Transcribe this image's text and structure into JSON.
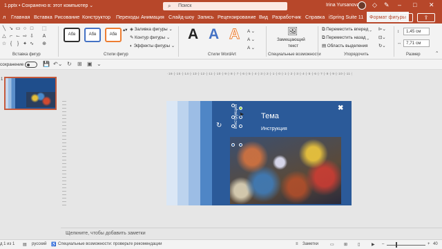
{
  "titlebar": {
    "filename": "1.pptx  •  Сохранено в: этот компьютер  ⌄",
    "search_placeholder": "Поиск",
    "user": "Irina Yursanova"
  },
  "tabs": [
    "Главная",
    "Вставка",
    "Рисование",
    "Конструктор",
    "Переходы",
    "Анимация",
    "Слайд-шоу",
    "Запись",
    "Рецензирование",
    "Вид",
    "Разработчик",
    "Справка",
    "iSpring Suite 11",
    "Формат фигуры"
  ],
  "ribbon": {
    "groups": {
      "insert_shapes": "Вставка фигур",
      "shape_styles": "Стили фигур",
      "wordart": "Стили WordArt",
      "accessibility": "Специальные возможности",
      "arrange": "Упорядочить",
      "size": "Размер"
    },
    "style_samples": [
      "Абв",
      "Абв",
      "Абв"
    ],
    "shape_fill": "Заливка фигуры ⌄",
    "shape_outline": "Контур фигуры ⌄",
    "shape_effects": "Эффекты фигуры ⌄",
    "wordart_letter": "A",
    "alt_text_line1": "Замещающий",
    "alt_text_line2": "текст",
    "bring_forward": "Переместить вперед",
    "send_backward": "Переместить назад",
    "selection_pane": "Область выделения",
    "height": "1,45 см",
    "width": "7,71 см"
  },
  "qat": {
    "autosave_label": "сохранение"
  },
  "ruler_text": "·16·|·15·|·14·|·13·|·12·|·11·|·10·|·9·|·8·|·7·|·6·|·5·|·4·|·3·|·2·|·1·|·0·|·1·|·2·|·3·|·4·|·5·|·6·|·7·|·8·|·9·|·10·|·11·|·12·|·13·|·14·|·15·|·16·",
  "thumbnail": {
    "number": "1"
  },
  "slide": {
    "title": "Тема",
    "subtitle": "Инструкция",
    "rotated_text": "Инструкция",
    "close_glyph": "✖"
  },
  "notes": {
    "placeholder": "Щелкните, чтобы добавить заметки"
  },
  "status": {
    "slide_of": "д 1 из 1",
    "language": "русский",
    "accessibility": "Специальные возможности: проверьте рекомендации",
    "notes_btn": "Заметки",
    "zoom": "40"
  },
  "colors": {
    "brand": "#b7472a",
    "slide_bg": "#2b5a99"
  }
}
